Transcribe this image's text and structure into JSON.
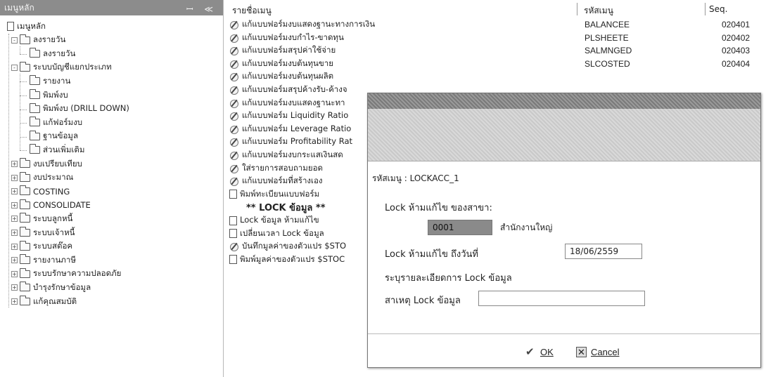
{
  "left_pane": {
    "title": "เมนูหลัก",
    "controls": "ꟷ ≪",
    "tree": [
      {
        "label": "เมนูหลัก",
        "level": 0,
        "icon": "doc-icon"
      },
      {
        "label": "ลงรายวัน",
        "level": 1,
        "icon": "folder-icon",
        "expander": "-"
      },
      {
        "label": "ลงรายวัน",
        "level": 2,
        "icon": "folder-icon"
      },
      {
        "label": "ระบบบัญชีแยกประเภท",
        "level": 1,
        "icon": "folder-icon",
        "expander": "-"
      },
      {
        "label": "รายงาน",
        "level": 2,
        "icon": "folder-icon"
      },
      {
        "label": "พิมพ์งบ",
        "level": 2,
        "icon": "folder-icon"
      },
      {
        "label": "พิมพ์งบ (DRILL DOWN)",
        "level": 2,
        "icon": "folder-icon"
      },
      {
        "label": "แก้ฟอร์มงบ",
        "level": 2,
        "icon": "folder-icon"
      },
      {
        "label": "ฐานข้อมูล",
        "level": 2,
        "icon": "folder-icon"
      },
      {
        "label": "ส่วนเพิ่มเติม",
        "level": 2,
        "icon": "folder-icon"
      },
      {
        "label": "งบเปรียบเทียบ",
        "level": 1,
        "icon": "folder-icon",
        "expander": "+"
      },
      {
        "label": "งบประมาณ",
        "level": 1,
        "icon": "folder-icon",
        "expander": "+"
      },
      {
        "label": "COSTING",
        "level": 1,
        "icon": "folder-icon",
        "expander": "+"
      },
      {
        "label": "CONSOLIDATE",
        "level": 1,
        "icon": "folder-icon",
        "expander": "+"
      },
      {
        "label": "ระบบลูกหนี้",
        "level": 1,
        "icon": "folder-icon",
        "expander": "+"
      },
      {
        "label": "ระบบเจ้าหนี้",
        "level": 1,
        "icon": "folder-icon",
        "expander": "+"
      },
      {
        "label": "ระบบสต๊อค",
        "level": 1,
        "icon": "folder-icon",
        "expander": "+"
      },
      {
        "label": "รายงานภาษี",
        "level": 1,
        "icon": "folder-icon",
        "expander": "+"
      },
      {
        "label": "ระบบรักษาความปลอดภัย",
        "level": 1,
        "icon": "folder-icon",
        "expander": "+"
      },
      {
        "label": "บำรุงรักษาข้อมูล",
        "level": 1,
        "icon": "folder-icon",
        "expander": "+"
      },
      {
        "label": "แก้คุณสมบัติ",
        "level": 1,
        "icon": "folder-icon",
        "expander": "+"
      }
    ]
  },
  "list": {
    "headers": {
      "name": "รายชื่อเมนู",
      "code": "รหัสเมนู",
      "seq": "Seq."
    },
    "rows": [
      {
        "icon": "pencil-icon",
        "name": "แก้แบบฟอร์มงบแสดงฐานะทางการเงิน",
        "code": "BALANCEE",
        "seq": "020401"
      },
      {
        "icon": "pencil-icon",
        "name": "แก้แบบฟอร์มงบกำไร-ขาดทุน",
        "code": "PLSHEETE",
        "seq": "020402"
      },
      {
        "icon": "pencil-icon",
        "name": "แก้แบบฟอร์มสรุปค่าใช้จ่าย",
        "code": "SALMNGED",
        "seq": "020403"
      },
      {
        "icon": "pencil-icon",
        "name": "แก้แบบฟอร์มงบต้นทุนขาย",
        "code": "SLCOSTED",
        "seq": "020404"
      },
      {
        "icon": "pencil-icon",
        "name": "แก้แบบฟอร์มงบต้นทุนผลิต",
        "code": "",
        "seq": ""
      },
      {
        "icon": "pencil-icon",
        "name": "แก้แบบฟอร์มสรุปค้างรับ-ค้างจ",
        "code": "",
        "seq": ""
      },
      {
        "icon": "pencil-icon",
        "name": "แก้แบบฟอร์มงบแสดงฐานะทา",
        "code": "",
        "seq": ""
      },
      {
        "icon": "pencil-icon",
        "name": "แก้แบบฟอร์ม Liquidity Ratio",
        "code": "",
        "seq": ""
      },
      {
        "icon": "pencil-icon",
        "name": "แก้แบบฟอร์ม Leverage Ratio",
        "code": "",
        "seq": ""
      },
      {
        "icon": "pencil-icon",
        "name": "แก้แบบฟอร์ม Profitability Rat",
        "code": "",
        "seq": ""
      },
      {
        "icon": "pencil-icon",
        "name": "แก้แบบฟอร์มงบกระแสเงินสด",
        "code": "",
        "seq": ""
      },
      {
        "icon": "pencil-icon",
        "name": "ใส่รายการสอบถามยอด",
        "code": "",
        "seq": ""
      },
      {
        "icon": "pencil-icon",
        "name": "แก้แบบฟอร์มที่สร้างเอง",
        "code": "",
        "seq": ""
      },
      {
        "icon": "doc-icon",
        "name": "พิมพ์ทะเบียนแบบฟอร์ม",
        "code": "",
        "seq": ""
      },
      {
        "icon": "none",
        "name": "** LOCK ข้อมูล **",
        "code": "",
        "seq": "",
        "bold": true
      },
      {
        "icon": "doc-icon",
        "name": "Lock ข้อมูล ห้ามแก้ไข",
        "code": "",
        "seq": ""
      },
      {
        "icon": "doc-icon",
        "name": "เปลี่ยนเวลา Lock ข้อมูล",
        "code": "",
        "seq": ""
      },
      {
        "icon": "pencil-icon",
        "name": "บันทึกมูลค่าของตัวแปร $STO",
        "code": "",
        "seq": ""
      },
      {
        "icon": "doc-icon",
        "name": "พิมพ์มูลค่าของตัวแปร $STOC",
        "code": "",
        "seq": ""
      }
    ]
  },
  "dialog": {
    "menu_code_label": "รหัสเมนู : LOCKACC_1",
    "branch_label": "Lock ห้ามแก้ไข ของสาขา:",
    "branch_code": "0001",
    "branch_name": "สำนักงานใหญ่",
    "date_label": "Lock ห้ามแก้ไข ถึงวันที่",
    "date_value": "18/06/2559",
    "detail_label": "ระบุรายละเอียดการ Lock ข้อมูล",
    "reason_label": "สาเหตุ Lock ข้อมูล",
    "reason_value": "",
    "ok_label": "OK",
    "cancel_label": "Cancel"
  }
}
